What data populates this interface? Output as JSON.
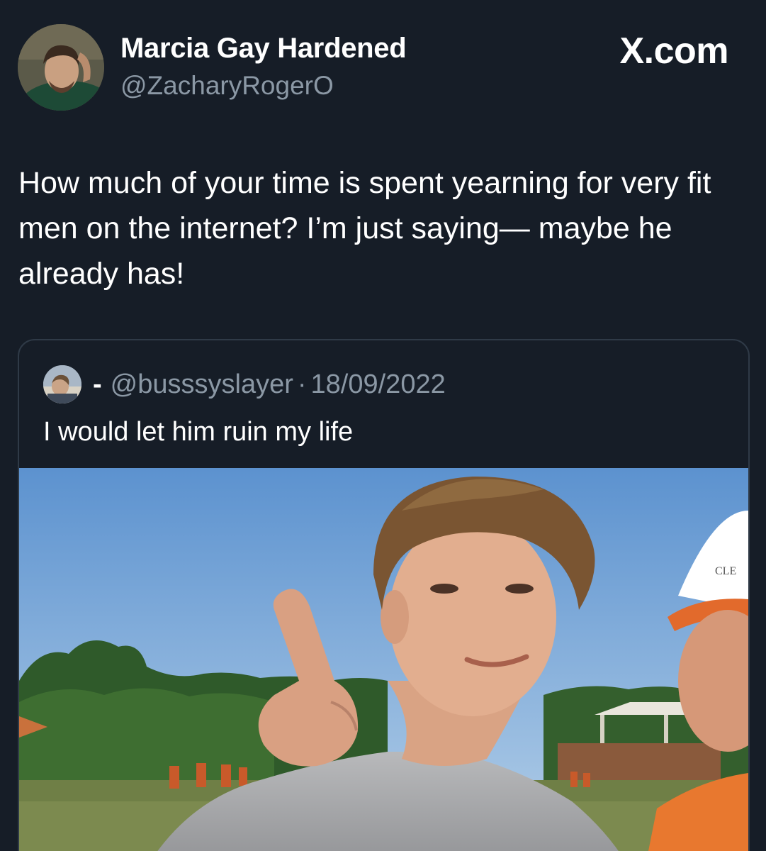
{
  "author": {
    "display_name": "Marcia Gay Hardened",
    "handle": "@ZacharyRogerO",
    "avatar_icon": "profile-photo"
  },
  "brand": {
    "label": "X.com"
  },
  "tweet": {
    "text": "How much of your time is spent yearning for very fit men on the internet? I’m just saying— maybe he already has!"
  },
  "quoted_tweet": {
    "display_name": "-",
    "handle": "@busssyslayer",
    "separator": "·",
    "date": "18/09/2022",
    "text": "I would let him ruin my life",
    "media_cap_text": "CLE"
  },
  "colors": {
    "background": "#161d27",
    "text_primary": "#ffffff",
    "text_secondary": "#8b98a5",
    "card_border": "#2f3a47"
  }
}
